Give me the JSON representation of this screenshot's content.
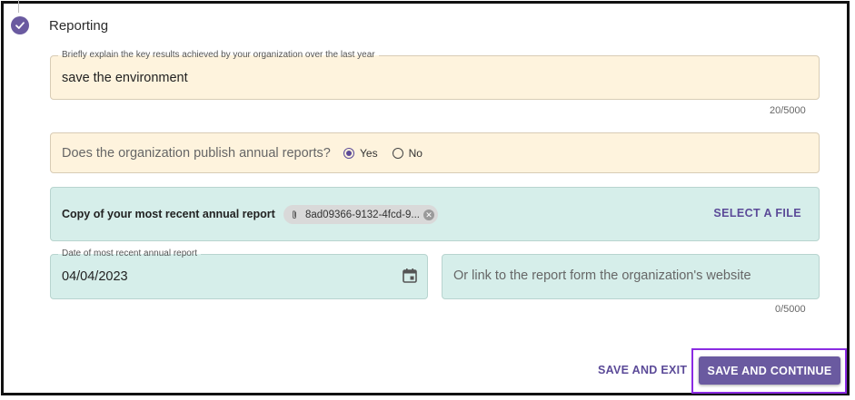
{
  "step": {
    "title": "Reporting",
    "icon": "check-circle-icon",
    "color": "#6a5aa0"
  },
  "key_results": {
    "label": "Briefly explain the key results achieved by your organization over the last year",
    "value": "save the environment",
    "counter": "20/5000"
  },
  "annual_reports": {
    "question": "Does the organization publish annual reports?",
    "options": [
      {
        "label": "Yes",
        "checked": true
      },
      {
        "label": "No",
        "checked": false
      }
    ]
  },
  "upload": {
    "label": "Copy of your most recent annual report",
    "file_name": "8ad09366-9132-4fcd-9...",
    "select_label": "SELECT A FILE"
  },
  "report_date": {
    "label": "Date of most recent annual report",
    "value": "04/04/2023"
  },
  "report_link": {
    "placeholder": "Or link to the report form the organization's website",
    "counter": "0/5000"
  },
  "actions": {
    "save_exit": "SAVE AND EXIT",
    "save_continue": "SAVE AND CONTINUE"
  },
  "colors": {
    "accent": "#6a5aa0",
    "yellow_field": "#fef3dd",
    "teal_field": "#d6eeea",
    "highlight": "#8a2be2"
  }
}
